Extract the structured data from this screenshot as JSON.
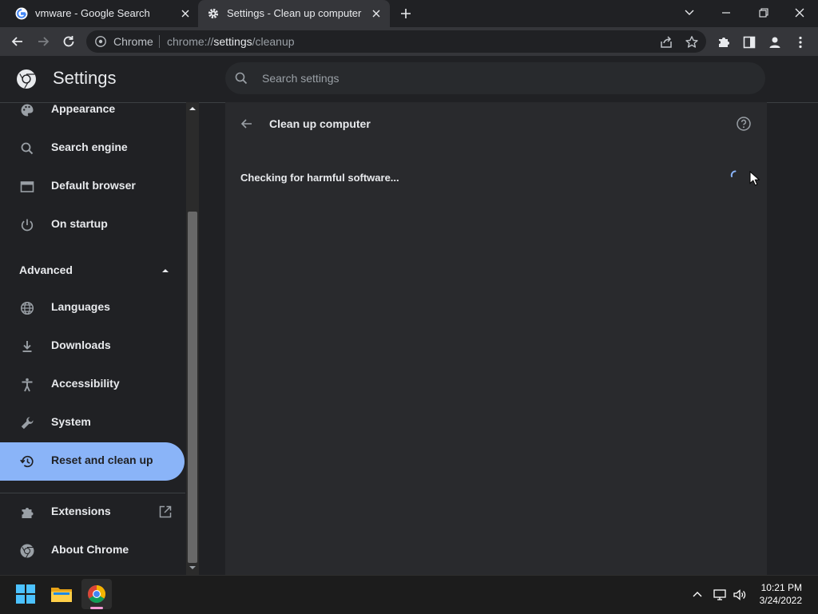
{
  "tabs": [
    {
      "title": "vmware - Google Search",
      "favicon": "google-icon",
      "active": false
    },
    {
      "title": "Settings - Clean up computer",
      "favicon": "gear-icon",
      "active": true
    }
  ],
  "omnibox": {
    "site_label": "Chrome",
    "url_scheme": "chrome://",
    "url_host": "settings",
    "url_path": "/cleanup"
  },
  "settings": {
    "title": "Settings",
    "search_placeholder": "Search settings",
    "nav": {
      "appearance": "Appearance",
      "search_engine": "Search engine",
      "default_browser": "Default browser",
      "on_startup": "On startup",
      "advanced": "Advanced",
      "languages": "Languages",
      "downloads": "Downloads",
      "accessibility": "Accessibility",
      "system": "System",
      "reset": "Reset and clean up",
      "extensions": "Extensions",
      "about": "About Chrome"
    },
    "selected_nav": "reset",
    "page": {
      "title": "Clean up computer",
      "status": "Checking for harmful software..."
    }
  },
  "taskbar": {
    "time": "10:21 PM",
    "date": "3/24/2022"
  },
  "colors": {
    "accent": "#8ab4f8",
    "background": "#202124",
    "card": "#292a2d",
    "toolbar": "#35363a"
  }
}
